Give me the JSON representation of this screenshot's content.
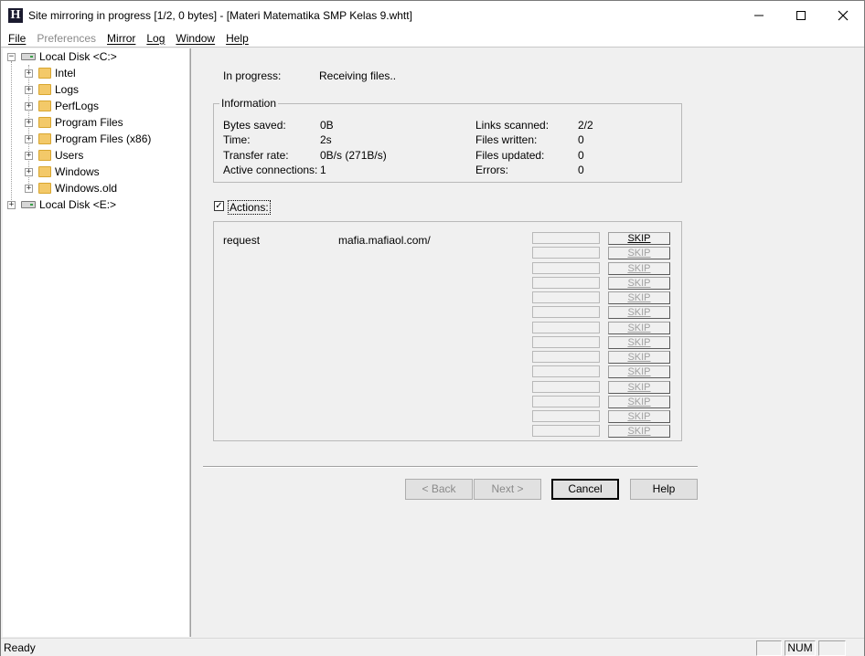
{
  "window": {
    "title": "Site mirroring in progress [1/2, 0 bytes] - [Materi Matematika SMP Kelas 9.whtt]",
    "app_icon_letter": "H",
    "minimize_icon": "minimize-icon",
    "maximize_icon": "maximize-icon",
    "close_icon": "close-icon"
  },
  "menu": {
    "items": [
      "File",
      "Preferences",
      "Mirror",
      "Log",
      "Window",
      "Help"
    ]
  },
  "tree": {
    "drive_c": "Local Disk <C:>",
    "folders": [
      "Intel",
      "Logs",
      "PerfLogs",
      "Program Files",
      "Program Files (x86)",
      "Users",
      "Windows",
      "Windows.old"
    ],
    "drive_e": "Local Disk <E:>",
    "expand_glyph": "+",
    "collapse_glyph": "−"
  },
  "progress": {
    "label": "In progress:",
    "value": "Receiving files.."
  },
  "information": {
    "title": "Information",
    "left": [
      {
        "label": "Bytes saved:",
        "value": "0B"
      },
      {
        "label": "Time:",
        "value": "2s"
      },
      {
        "label": "Transfer rate:",
        "value": "0B/s (271B/s)"
      },
      {
        "label": "Active connections:",
        "value": "1"
      }
    ],
    "right": [
      {
        "label": "Links scanned:",
        "value": "2/2"
      },
      {
        "label": "Files written:",
        "value": "0"
      },
      {
        "label": "Files updated:",
        "value": "0"
      },
      {
        "label": "Errors:",
        "value": "0"
      }
    ]
  },
  "actions": {
    "checkbox_label": "Actions:",
    "checked_glyph": "✓",
    "request_label": "request",
    "request_url": "mafia.mafiaol.com/",
    "skip_label": "SKIP"
  },
  "buttons": {
    "back": "< Back",
    "next": "Next >",
    "cancel": "Cancel",
    "help": "Help"
  },
  "status": {
    "text": "Ready",
    "num": "NUM"
  }
}
